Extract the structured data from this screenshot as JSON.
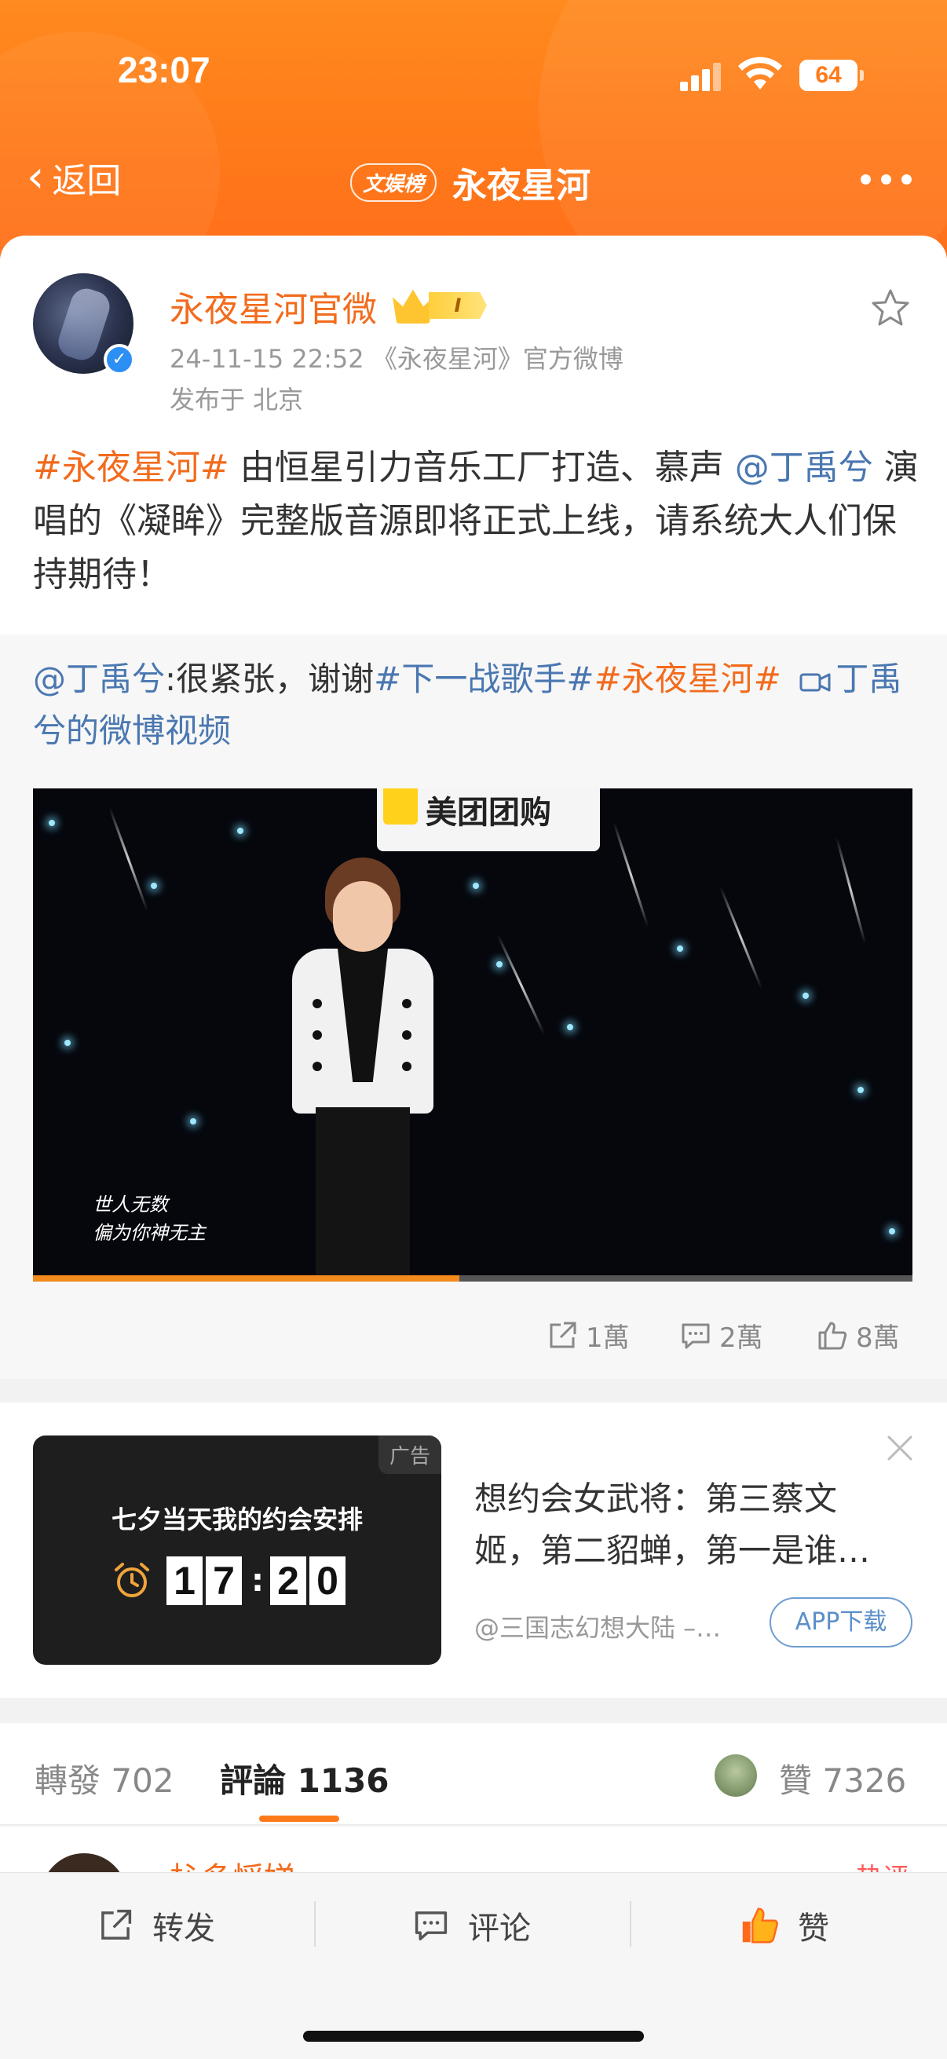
{
  "status_bar": {
    "time": "23:07",
    "battery": "64"
  },
  "nav": {
    "back_label": "返回",
    "badge": "文娱榜",
    "title": "永夜星河"
  },
  "post": {
    "author": "永夜星河官微",
    "rank_badge": "I",
    "timestamp": "24-11-15 22:52",
    "source": "《永夜星河》官方微博",
    "location": "发布于 北京",
    "text": {
      "tag": "#永夜星河#",
      "part1": " 由恒星引力音乐工厂打造、慕声 ",
      "mention": "@丁禹兮",
      "part2": " 演唱的《凝眸》完整版音源即将正式上线，请系统大人们保持期待！"
    }
  },
  "repost": {
    "mention": "@丁禹兮",
    "text1": ":很紧张，谢谢",
    "tag1": "#下一战歌手#",
    "tag2": "#永夜星河#",
    "video_link": "丁禹兮的微博视频",
    "video": {
      "sign_text": "美团团购",
      "subtitle_line1": "世人无数",
      "subtitle_line2": "偏为你神无主",
      "progress": 0.485
    },
    "stats": {
      "reposts": "1萬",
      "comments": "2萬",
      "likes": "8萬"
    }
  },
  "ad": {
    "label": "广告",
    "tile_heading": "七夕当天我的约会安排",
    "time_digits": [
      "1",
      "7",
      "2",
      "0"
    ],
    "title": "想约会女武将：第三蔡文姬，第二貂蝉，第一是谁…",
    "source": "@三国志幻想大陆 –…",
    "cta": "APP下载"
  },
  "tabs": {
    "repost_label": "轉發",
    "repost_count": "702",
    "comment_label": "評論",
    "comment_count": "1136",
    "like_label": "贊",
    "like_count": "7326"
  },
  "comment_peek": {
    "name": "杺多慆娣",
    "hot": "热评"
  },
  "bottom_bar": {
    "repost": "转发",
    "comment": "评论",
    "like": "赞"
  },
  "colors": {
    "brand_orange": "#ff7a1a",
    "tag_orange": "#f26b1d",
    "mention_blue": "#4a77b0",
    "like_orange": "#ff6a1a"
  }
}
